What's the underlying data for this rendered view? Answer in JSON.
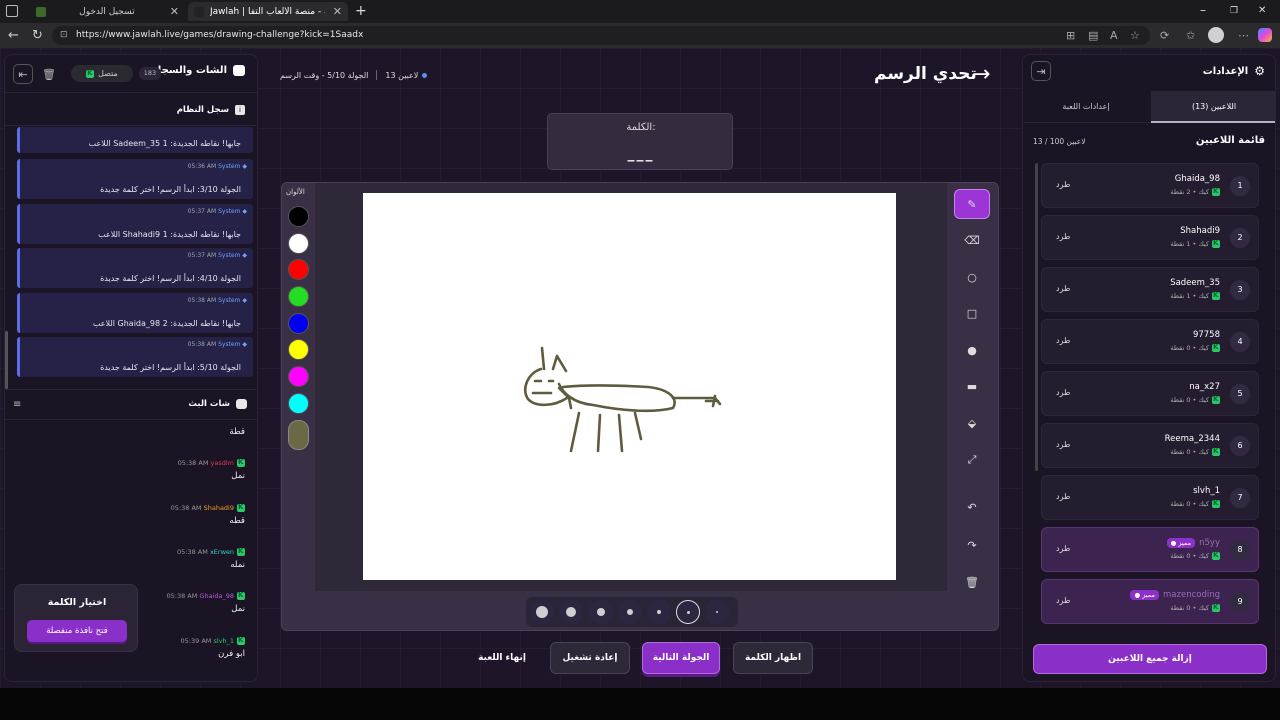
{
  "browser": {
    "tabs": [
      {
        "label": "تسجيل الدخول"
      },
      {
        "label": "Jawlah | جولة - منصة الألعاب التفا..."
      }
    ],
    "new_tab": "+",
    "url": "https://www.jawlah.live/games/drawing-challenge?kick=1Saadx"
  },
  "chat_panel": {
    "title": "الشات والسجل",
    "count": "183",
    "status": "متصل",
    "system_log_title": "سجل النظام",
    "log": [
      {
        "time": "",
        "sender": "",
        "text": "اللاعب Sadeem_35 جابها! نقاطه الجديدة: 1"
      },
      {
        "time": "05:36 AM",
        "sender": "System",
        "text": "الجولة 3/10: ابدأ الرسم! اختر كلمة جديدة"
      },
      {
        "time": "05:37 AM",
        "sender": "System",
        "text": "اللاعب Shahadi9 جابها! نقاطه الجديدة: 1"
      },
      {
        "time": "05:37 AM",
        "sender": "System",
        "text": "الجولة 4/10: ابدأ الرسم! اختر كلمة جديدة"
      },
      {
        "time": "05:38 AM",
        "sender": "System",
        "text": "اللاعب Ghaida_98 جابها! نقاطه الجديدة: 2"
      },
      {
        "time": "05:38 AM",
        "sender": "System",
        "text": "الجولة 5/10: ابدأ الرسم! اختر كلمة جديدة"
      }
    ],
    "live_chat_title": "شات البث",
    "messages": [
      {
        "user": "",
        "time": "",
        "text": "قطة",
        "color": "#ffffff"
      },
      {
        "user": "yasdlm",
        "time": "05:38 AM",
        "text": "نمل",
        "color": "#e8384f"
      },
      {
        "user": "Shahadi9",
        "time": "05:38 AM",
        "text": "قطه",
        "color": "#f0a020"
      },
      {
        "user": "xErwen",
        "time": "05:38 AM",
        "text": "نمله",
        "color": "#3fd0d0"
      },
      {
        "user": "Ghaida_98",
        "time": "05:38 AM",
        "text": "نمل",
        "color": "#c05ad8"
      },
      {
        "user": "slvh_1",
        "time": "05:39 AM",
        "text": "ابو فرن",
        "color": "#2fc96a"
      }
    ]
  },
  "word_popup": {
    "title": "اختيار الكلمة",
    "button": "فتح نافذة منفصلة"
  },
  "game": {
    "title": "تحدي الرسم",
    "players_info": "13 لاعبين",
    "round_info": "الجولة 5/10 - وقت الرسم",
    "word_label": "الكلمة:",
    "word_mask": "___",
    "colors_label": "الألوان",
    "colors": [
      "#000000",
      "#ffffff",
      "#ff0000",
      "#22dd22",
      "#0000ee",
      "#ffff00",
      "#ff00ff",
      "#00ffff",
      "#6b6845"
    ],
    "tools": [
      "pencil-icon",
      "eraser-icon",
      "circle-icon",
      "square-icon",
      "filled-circle-icon",
      "filled-rect-icon",
      "fill-icon",
      "line-icon",
      "undo-icon",
      "redo-icon",
      "trash-icon"
    ],
    "active_tool": "pencil-icon",
    "brush_sizes": 7,
    "active_size": 2
  },
  "actions": {
    "end_game": "إنهاء اللعبة",
    "restart": "إعادة تشغيل",
    "next_round": "الجولة التالية",
    "show_word": "اظهار الكلمة"
  },
  "settings_panel": {
    "title": "الإعدادات",
    "tab_players": "اللاعبين (13)",
    "tab_game_settings": "إعدادات اللعبة",
    "list_title": "قائمة اللاعبين",
    "list_count": "13 / 100 لاعبين",
    "kick_label": "طرد",
    "players": [
      {
        "rank": "1",
        "name": "Ghaida_98",
        "meta": "كيك • 2 نقطة",
        "vip": false
      },
      {
        "rank": "2",
        "name": "Shahadi9",
        "meta": "كيك • 1 نقطة",
        "vip": false
      },
      {
        "rank": "3",
        "name": "Sadeem_35",
        "meta": "كيك • 1 نقطة",
        "vip": false
      },
      {
        "rank": "4",
        "name": "97758",
        "meta": "كيك • 0 نقطة",
        "vip": false
      },
      {
        "rank": "5",
        "name": "na_x27",
        "meta": "كيك • 0 نقطة",
        "vip": false
      },
      {
        "rank": "6",
        "name": "Reema_2344",
        "meta": "كيك • 0 نقطة",
        "vip": false
      },
      {
        "rank": "7",
        "name": "slvh_1",
        "meta": "كيك • 0 نقطة",
        "vip": false
      },
      {
        "rank": "8",
        "name": "n5yy",
        "meta": "كيك • 0 نقطة",
        "vip": true,
        "badge": "● مميز"
      },
      {
        "rank": "9",
        "name": "mazencoding",
        "meta": "كيك • 0 نقطة",
        "vip": true,
        "badge": "● مميز"
      }
    ],
    "remove_all": "إزالة جميع اللاعبين"
  }
}
